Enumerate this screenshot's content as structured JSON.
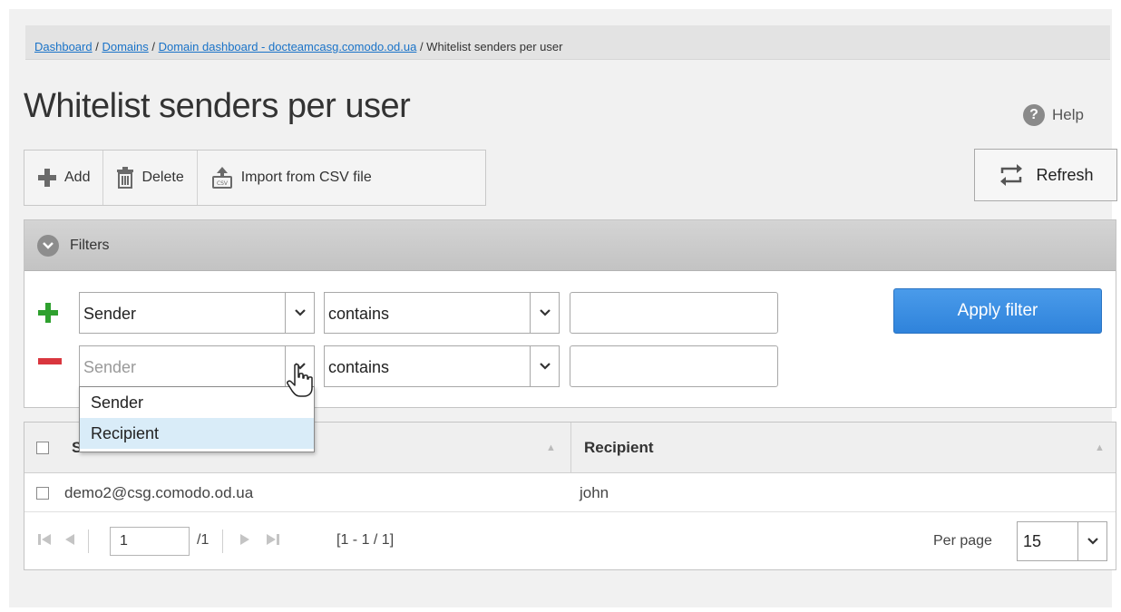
{
  "breadcrumb": {
    "items": [
      "Dashboard",
      "Domains",
      "Domain dashboard - docteamcasg.comodo.od.ua"
    ],
    "separator": " / ",
    "current": "Whitelist senders per user"
  },
  "page": {
    "title": "Whitelist senders per user"
  },
  "help": {
    "label": "Help",
    "icon": "question-mark-icon"
  },
  "toolbar": {
    "add_label": "Add",
    "delete_label": "Delete",
    "import_label": "Import from CSV file",
    "refresh_label": "Refresh"
  },
  "filters": {
    "header": "Filters",
    "rows": [
      {
        "field": "Sender",
        "operator": "contains",
        "value": ""
      },
      {
        "field": "Sender",
        "operator": "contains",
        "value": ""
      }
    ],
    "apply_label": "Apply filter",
    "dropdown_options": [
      "Sender",
      "Recipient"
    ],
    "dropdown_highlighted": "Recipient"
  },
  "table": {
    "columns": [
      "Sender",
      "Recipient"
    ],
    "rows": [
      {
        "sender": "demo2@csg.comodo.od.ua",
        "recipient": "john"
      }
    ]
  },
  "pager": {
    "page": "1",
    "total_pages": "/1",
    "range": "[1 - 1 / 1]",
    "per_page_label": "Per page",
    "per_page": "15"
  },
  "colors": {
    "link": "#1a73c8",
    "apply_button": "#3a8fe2",
    "plus_green": "#2ea02e",
    "minus_red": "#d9363e",
    "dropdown_highlight": "#d9ecf8"
  }
}
